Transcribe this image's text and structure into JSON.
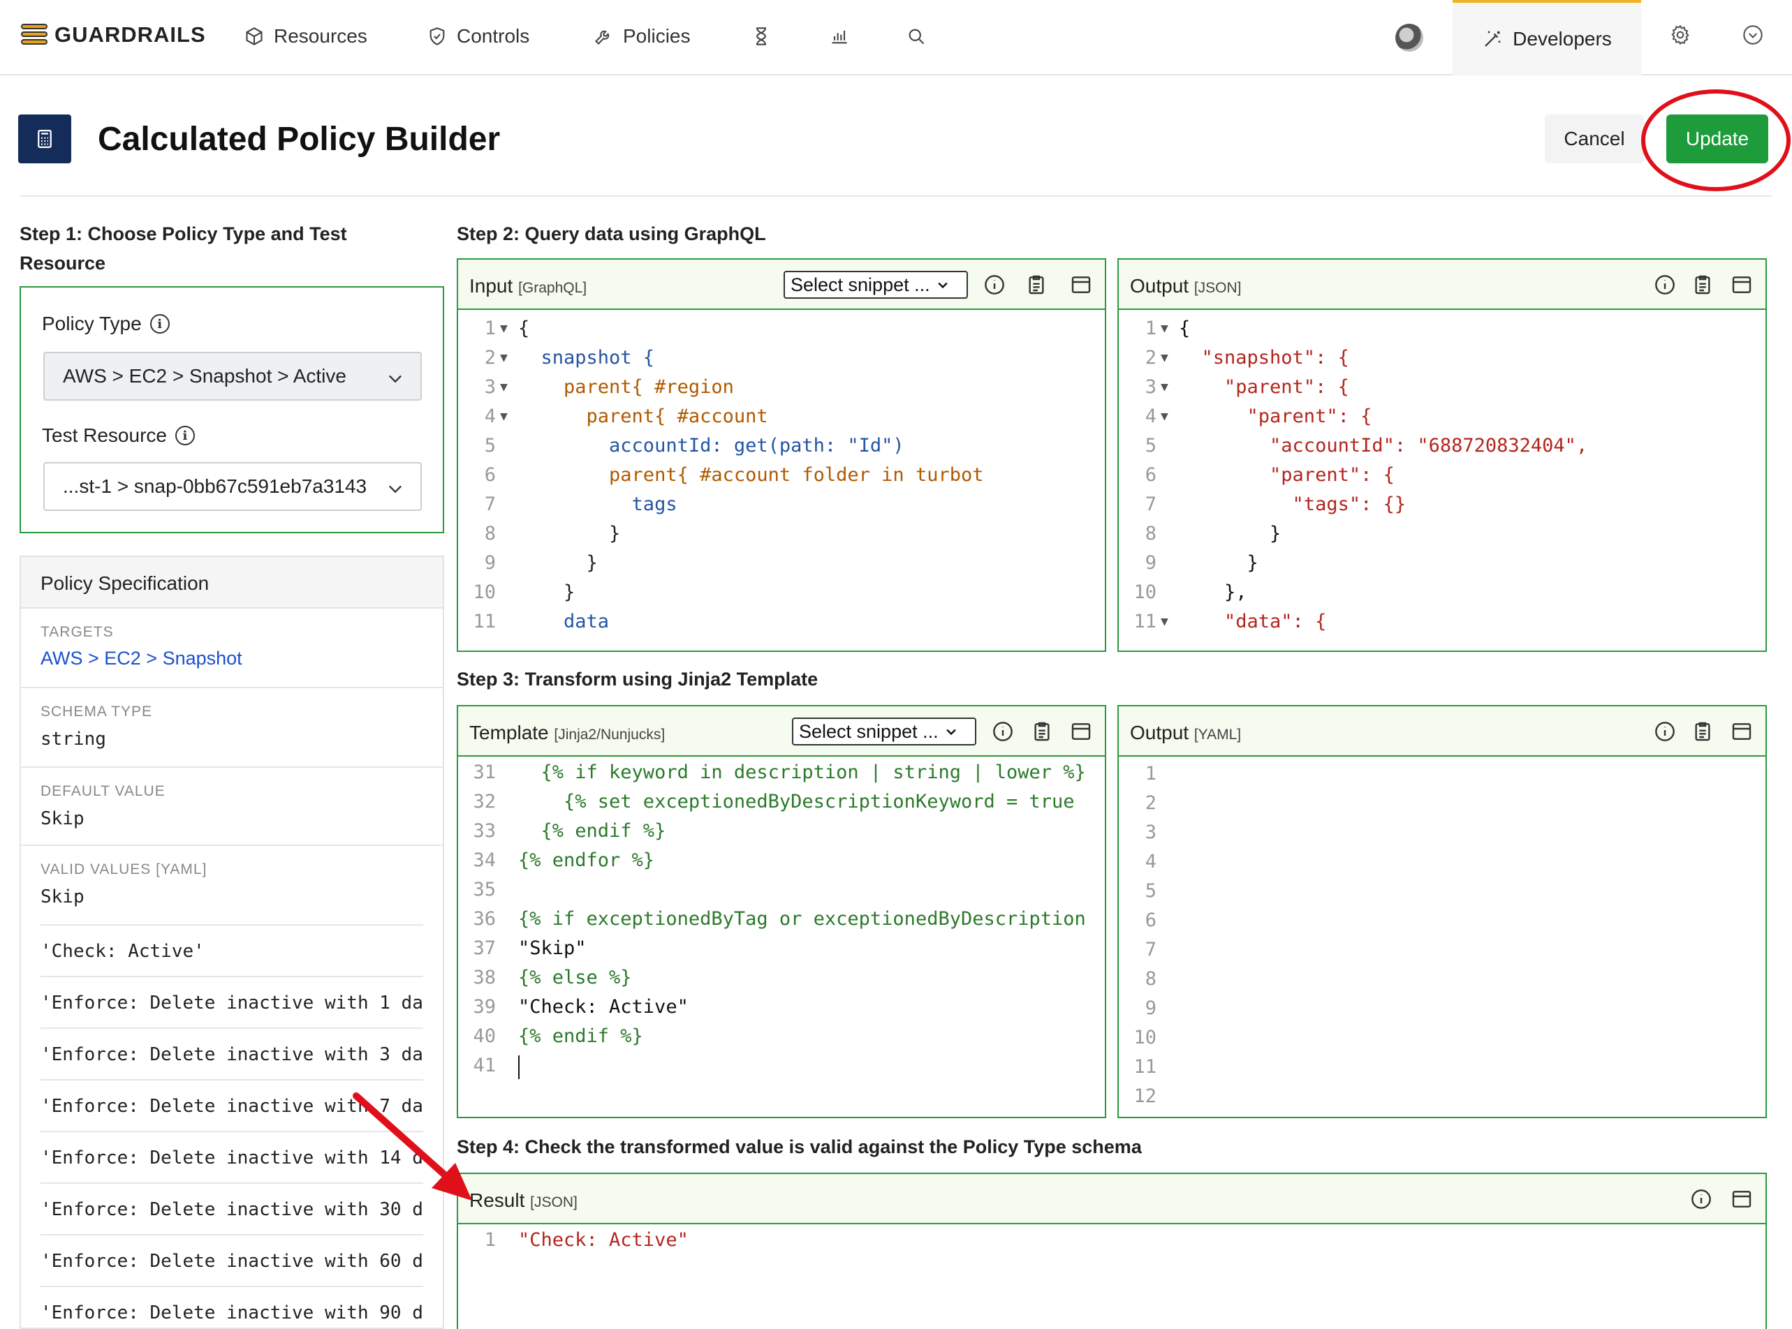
{
  "nav": {
    "brand": "GUARDRAILS",
    "items": [
      {
        "label": "Resources"
      },
      {
        "label": "Controls"
      },
      {
        "label": "Policies"
      }
    ],
    "developers": "Developers"
  },
  "header": {
    "title": "Calculated Policy Builder",
    "cancel": "Cancel",
    "update": "Update"
  },
  "step1": {
    "title": "Step 1: Choose Policy Type and Test Resource",
    "policy_type_label": "Policy Type",
    "policy_type_value": "AWS > EC2 > Snapshot > Active",
    "test_resource_label": "Test Resource",
    "test_resource_value": "...st-1 > snap-0bb67c591eb7a3143"
  },
  "spec": {
    "title": "Policy Specification",
    "targets_label": "TARGETS",
    "targets_value": "AWS > EC2 > Snapshot",
    "schema_label": "SCHEMA TYPE",
    "schema_value": "string",
    "default_label": "DEFAULT VALUE",
    "default_value": "Skip",
    "valid_label": "VALID VALUES [YAML]",
    "valid_values": [
      "Skip",
      "'Check: Active'",
      "'Enforce: Delete inactive with 1 da",
      "'Enforce: Delete inactive with 3 da",
      "'Enforce: Delete inactive with 7 da",
      "'Enforce: Delete inactive with 14 d",
      "'Enforce: Delete inactive with 30 d",
      "'Enforce: Delete inactive with 60 d",
      "'Enforce: Delete inactive with 90 d"
    ]
  },
  "step2": {
    "title": "Step 2: Query data using GraphQL",
    "input_title": "Input",
    "input_sub": "[GraphQL]",
    "output_title": "Output",
    "output_sub": "[JSON]",
    "snippet": "Select snippet ...",
    "input_lines": [
      {
        "n": "1",
        "fold": true,
        "text": "{"
      },
      {
        "n": "2",
        "fold": true,
        "text": "  snapshot {"
      },
      {
        "n": "3",
        "fold": true,
        "text": "    parent{ #region"
      },
      {
        "n": "4",
        "fold": true,
        "text": "      parent{ #account"
      },
      {
        "n": "5",
        "fold": false,
        "text": "        accountId: get(path: \"Id\")"
      },
      {
        "n": "6",
        "fold": false,
        "text": "        parent{ #account folder in turbot"
      },
      {
        "n": "7",
        "fold": false,
        "text": "          tags"
      },
      {
        "n": "8",
        "fold": false,
        "text": "        }"
      },
      {
        "n": "9",
        "fold": false,
        "text": "      }"
      },
      {
        "n": "10",
        "fold": false,
        "text": "    }"
      },
      {
        "n": "11",
        "fold": false,
        "text": "    data"
      }
    ],
    "output_lines": [
      {
        "n": "1",
        "fold": true,
        "text": "{"
      },
      {
        "n": "2",
        "fold": true,
        "text": "  \"snapshot\": {"
      },
      {
        "n": "3",
        "fold": true,
        "text": "    \"parent\": {"
      },
      {
        "n": "4",
        "fold": true,
        "text": "      \"parent\": {"
      },
      {
        "n": "5",
        "fold": false,
        "text": "        \"accountId\": \"688720832404\","
      },
      {
        "n": "6",
        "fold": false,
        "text": "        \"parent\": {"
      },
      {
        "n": "7",
        "fold": false,
        "text": "          \"tags\": {}"
      },
      {
        "n": "8",
        "fold": false,
        "text": "        }"
      },
      {
        "n": "9",
        "fold": false,
        "text": "      }"
      },
      {
        "n": "10",
        "fold": false,
        "text": "    },"
      },
      {
        "n": "11",
        "fold": true,
        "text": "    \"data\": {"
      }
    ]
  },
  "step3": {
    "title": "Step 3: Transform using Jinja2 Template",
    "template_title": "Template",
    "template_sub": "[Jinja2/Nunjucks]",
    "output_title": "Output",
    "output_sub": "[YAML]",
    "snippet": "Select snippet ...",
    "template_lines": [
      {
        "n": "31",
        "text": "  {% if keyword in description | string | lower %}"
      },
      {
        "n": "32",
        "text": "    {% set exceptionedByDescriptionKeyword = true"
      },
      {
        "n": "33",
        "text": "  {% endif %}"
      },
      {
        "n": "34",
        "text": "{% endfor %}"
      },
      {
        "n": "35",
        "text": ""
      },
      {
        "n": "36",
        "text": "{% if exceptionedByTag or exceptionedByDescription"
      },
      {
        "n": "37",
        "text": "\"Skip\""
      },
      {
        "n": "38",
        "text": "{% else %}"
      },
      {
        "n": "39",
        "text": "\"Check: Active\""
      },
      {
        "n": "40",
        "text": "{% endif %}"
      },
      {
        "n": "41",
        "text": ""
      }
    ],
    "output_numbers": [
      "1",
      "2",
      "3",
      "4",
      "5",
      "6",
      "7",
      "8",
      "9",
      "10",
      "11",
      "12"
    ]
  },
  "step4": {
    "title": "Step 4: Check the transformed value is valid against the Policy Type schema",
    "result_title": "Result",
    "result_sub": "[JSON]",
    "result_lines": [
      {
        "n": "1",
        "text": "\"Check: Active\""
      }
    ]
  },
  "colors": {
    "accent_green": "#1e9c3c",
    "panel_border": "#2a9a3e",
    "annotation_red": "#e0101a",
    "dev_tab_accent": "#f0b323"
  }
}
